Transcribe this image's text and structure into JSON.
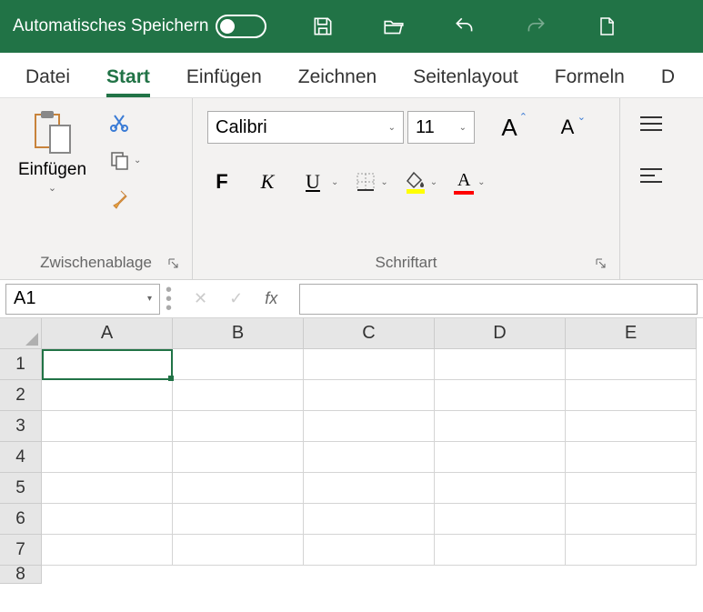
{
  "titlebar": {
    "autosave_label": "Automatisches Speichern"
  },
  "tabs": {
    "datei": "Datei",
    "start": "Start",
    "einfuegen": "Einfügen",
    "zeichnen": "Zeichnen",
    "seitenlayout": "Seitenlayout",
    "formeln": "Formeln",
    "partial": "D"
  },
  "ribbon": {
    "clipboard": {
      "paste_label": "Einfügen",
      "group_label": "Zwischenablage"
    },
    "font": {
      "font_name": "Calibri",
      "font_size": "11",
      "group_label": "Schriftart",
      "bold": "F",
      "italic": "K",
      "underline": "U",
      "grow": "A",
      "shrink": "A",
      "fill_letter": "",
      "color_letter": "A"
    }
  },
  "namebox": {
    "value": "A1"
  },
  "grid": {
    "columns": [
      "A",
      "B",
      "C",
      "D",
      "E"
    ],
    "rows": [
      "1",
      "2",
      "3",
      "4",
      "5",
      "6",
      "7",
      "8"
    ]
  }
}
